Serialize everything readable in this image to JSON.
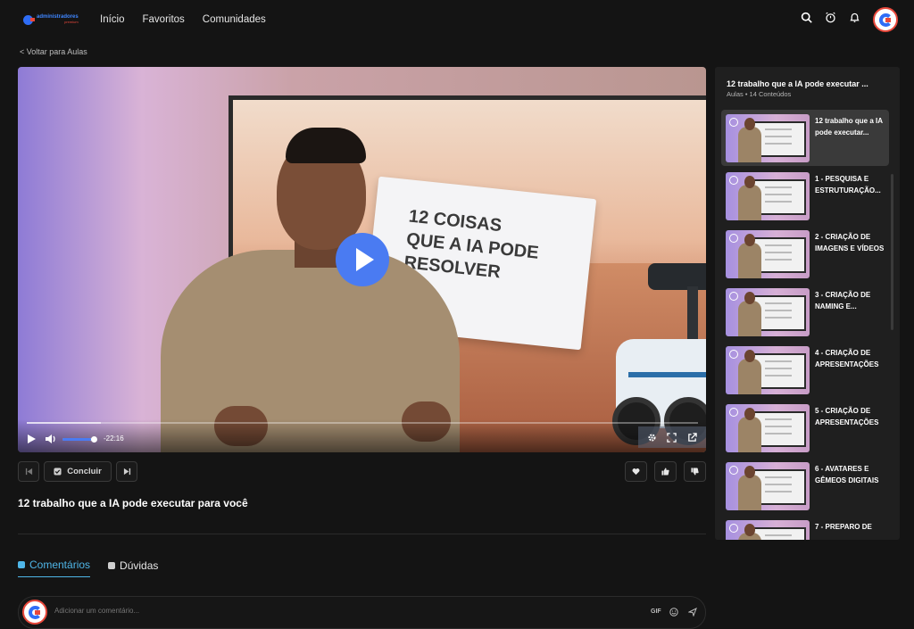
{
  "header": {
    "logo_line1": "administradores",
    "logo_line2": "premium",
    "nav": [
      "Início",
      "Favoritos",
      "Comunidades"
    ]
  },
  "back_link": "< Voltar para Aulas",
  "video": {
    "flag_lines": [
      "12 COISAS",
      "QUE A IA PODE",
      "RESOLVER"
    ],
    "remaining_time": "-22:16",
    "progress": 0.11,
    "volume": 0.9
  },
  "actions": {
    "complete_label": "Concluir"
  },
  "lesson_title": "12 trabalho que a IA pode executar para você",
  "tabs": [
    {
      "label": "Comentários",
      "active": true
    },
    {
      "label": "Dúvidas",
      "active": false
    }
  ],
  "comment": {
    "placeholder": "Adicionar um comentário...",
    "gif_label": "GIF"
  },
  "playlist": {
    "title": "12 trabalho que a IA pode executar ...",
    "subtitle": "Aulas • 14 Conteúdos",
    "items": [
      {
        "label": "12 trabalho que a IA pode executar..."
      },
      {
        "label": "1 - PESQUISA E ESTRUTURAÇÃO..."
      },
      {
        "label": "2 - CRIAÇÃO DE IMAGENS E VÍDEOS"
      },
      {
        "label": "3 - CRIAÇÃO DE NAMING E..."
      },
      {
        "label": "4 - CRIAÇÃO DE APRESENTAÇÕES ..."
      },
      {
        "label": "5 - CRIAÇÃO DE APRESENTAÇÕES ..."
      },
      {
        "label": "6 - AVATARES E GÊMEOS DIGITAIS"
      },
      {
        "label": "7 - PREPARO DE"
      }
    ]
  },
  "colors": {
    "accent_blue": "#4a7bf2",
    "tab_active": "#4fb6e8",
    "background": "#141414",
    "panel": "#1f1f1f"
  },
  "icons": [
    "search-icon",
    "alarm-icon",
    "bell-icon",
    "play-icon",
    "volume-icon",
    "gear-icon",
    "fullscreen-icon",
    "external-icon",
    "skip-back-icon",
    "check-icon",
    "skip-forward-icon",
    "heart-icon",
    "thumbs-up-icon",
    "thumbs-down-icon",
    "emoji-icon",
    "send-icon"
  ]
}
